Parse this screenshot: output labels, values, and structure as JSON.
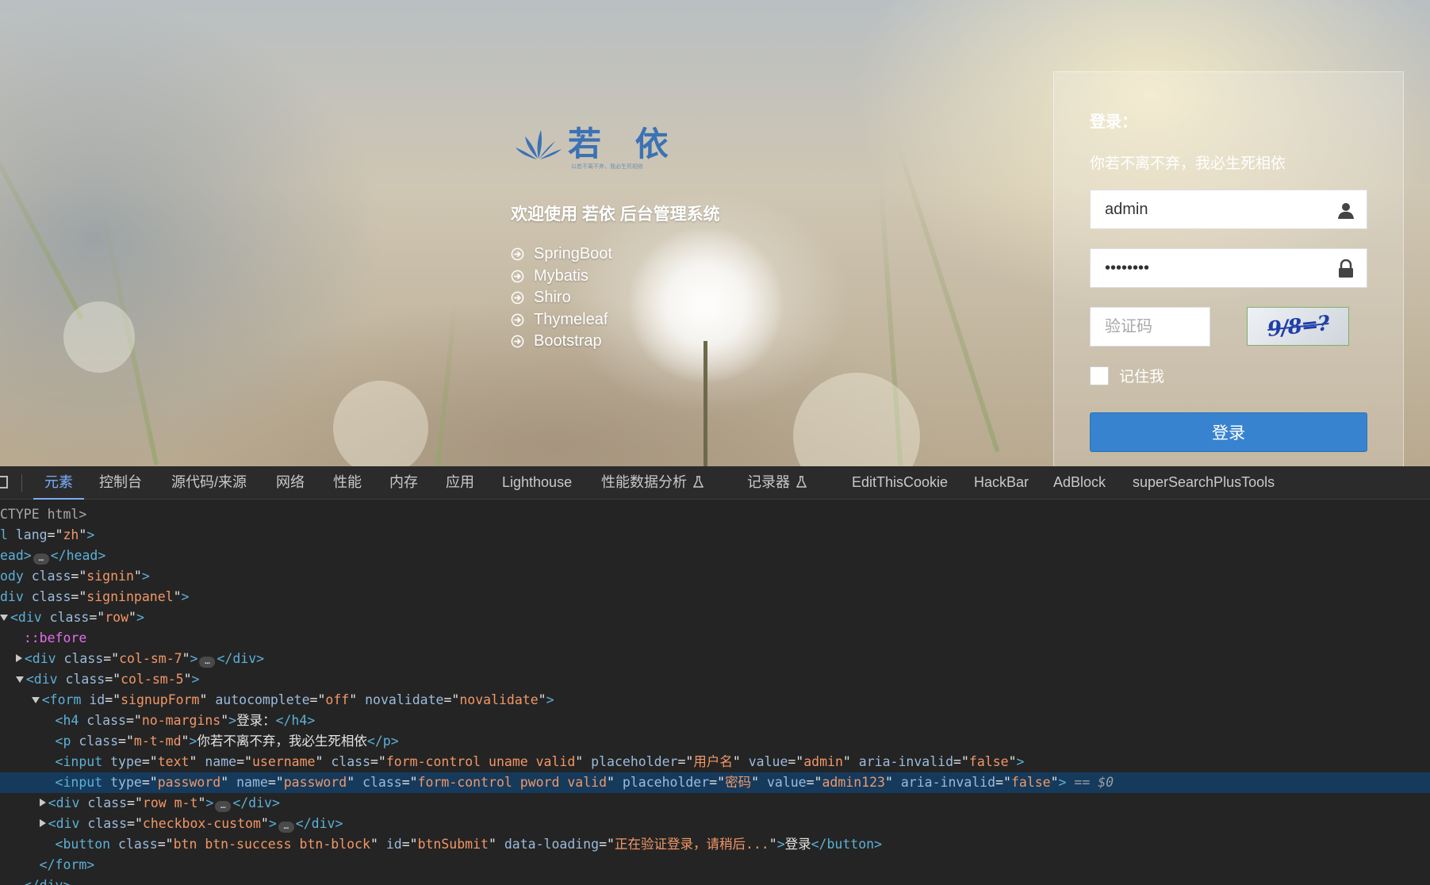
{
  "login_page": {
    "brand_name": "若 依",
    "brand_slogan": "以若不离不弃，我必生死相依",
    "welcome": "欢迎使用 若依 后台管理系统",
    "tech_stack": [
      "SpringBoot",
      "Mybatis",
      "Shiro",
      "Thymeleaf",
      "Bootstrap"
    ],
    "form": {
      "title": "登录：",
      "subtitle": "你若不离不弃，我必生死相依",
      "username_value": "admin",
      "username_placeholder": "用户名",
      "password_value": "admin123",
      "password_placeholder": "密码",
      "captcha_placeholder": "验证码",
      "captcha_text": "9/8=?",
      "remember_label": "记住我",
      "remember_checked": false,
      "submit_label": "登录"
    },
    "accent_color": "#3883d0"
  },
  "devtools": {
    "tabs": [
      {
        "label": "元素",
        "active": true
      },
      {
        "label": "控制台"
      },
      {
        "label": "源代码/来源"
      },
      {
        "label": "网络"
      },
      {
        "label": "性能"
      },
      {
        "label": "内存"
      },
      {
        "label": "应用"
      },
      {
        "label": "Lighthouse"
      },
      {
        "label": "性能数据分析",
        "icon": "flask-icon"
      },
      {
        "label": "记录器",
        "icon": "flask-icon"
      },
      {
        "label": "EditThisCookie"
      },
      {
        "label": "HackBar"
      },
      {
        "label": "AdBlock"
      },
      {
        "label": "superSearchPlusTools"
      }
    ],
    "dom_lines": [
      {
        "tokens": [
          [
            "cm",
            "CTYPE html>"
          ]
        ]
      },
      {
        "tokens": [
          [
            "tg",
            "l "
          ],
          [
            "an",
            "lang"
          ],
          [
            "tx",
            "=\""
          ],
          [
            "av",
            "zh"
          ],
          [
            "tx",
            "\""
          ],
          [
            "tg",
            ">"
          ]
        ]
      },
      {
        "tokens": [
          [
            "tg",
            "ead>"
          ],
          [
            "ell",
            "…"
          ],
          [
            "tg",
            "</head>"
          ]
        ]
      },
      {
        "tokens": [
          [
            "tg",
            "ody "
          ],
          [
            "an",
            "class"
          ],
          [
            "tx",
            "=\""
          ],
          [
            "av",
            "signin"
          ],
          [
            "tx",
            "\""
          ],
          [
            "tg",
            ">"
          ]
        ]
      },
      {
        "tokens": [
          [
            "tg",
            "div "
          ],
          [
            "an",
            "class"
          ],
          [
            "tx",
            "=\""
          ],
          [
            "av",
            "signinpanel"
          ],
          [
            "tx",
            "\""
          ],
          [
            "tg",
            ">"
          ]
        ]
      },
      {
        "tokens": [
          [
            "trid",
            ""
          ],
          [
            "tg",
            "<div "
          ],
          [
            "an",
            "class"
          ],
          [
            "tx",
            "=\""
          ],
          [
            "av",
            "row"
          ],
          [
            "tx",
            "\""
          ],
          [
            "tg",
            ">"
          ]
        ]
      },
      {
        "tokens": [
          [
            "tx",
            "   "
          ],
          [
            "ps",
            "::before"
          ]
        ]
      },
      {
        "tokens": [
          [
            "tx",
            "  "
          ],
          [
            "trir",
            ""
          ],
          [
            "tg",
            "<div "
          ],
          [
            "an",
            "class"
          ],
          [
            "tx",
            "=\""
          ],
          [
            "av",
            "col-sm-7"
          ],
          [
            "tx",
            "\""
          ],
          [
            "tg",
            ">"
          ],
          [
            "ell",
            "…"
          ],
          [
            "tg",
            "</div>"
          ]
        ]
      },
      {
        "tokens": [
          [
            "tx",
            "  "
          ],
          [
            "trid",
            ""
          ],
          [
            "tg",
            "<div "
          ],
          [
            "an",
            "class"
          ],
          [
            "tx",
            "=\""
          ],
          [
            "av",
            "col-sm-5"
          ],
          [
            "tx",
            "\""
          ],
          [
            "tg",
            ">"
          ]
        ]
      },
      {
        "tokens": [
          [
            "tx",
            "    "
          ],
          [
            "trid",
            ""
          ],
          [
            "tg",
            "<form "
          ],
          [
            "an",
            "id"
          ],
          [
            "tx",
            "=\""
          ],
          [
            "av",
            "signupForm"
          ],
          [
            "tx",
            "\" "
          ],
          [
            "an",
            "autocomplete"
          ],
          [
            "tx",
            "=\""
          ],
          [
            "av",
            "off"
          ],
          [
            "tx",
            "\" "
          ],
          [
            "an",
            "novalidate"
          ],
          [
            "tx",
            "=\""
          ],
          [
            "av",
            "novalidate"
          ],
          [
            "tx",
            "\""
          ],
          [
            "tg",
            ">"
          ]
        ]
      },
      {
        "tokens": [
          [
            "tx",
            "       "
          ],
          [
            "tg",
            "<h4 "
          ],
          [
            "an",
            "class"
          ],
          [
            "tx",
            "=\""
          ],
          [
            "av",
            "no-margins"
          ],
          [
            "tx",
            "\""
          ],
          [
            "tg",
            ">"
          ],
          [
            "tx",
            "登录："
          ],
          [
            "tg",
            "</h4>"
          ]
        ]
      },
      {
        "tokens": [
          [
            "tx",
            "       "
          ],
          [
            "tg",
            "<p "
          ],
          [
            "an",
            "class"
          ],
          [
            "tx",
            "=\""
          ],
          [
            "av",
            "m-t-md"
          ],
          [
            "tx",
            "\""
          ],
          [
            "tg",
            ">"
          ],
          [
            "tx",
            "你若不离不弃，我必生死相依"
          ],
          [
            "tg",
            "</p>"
          ]
        ]
      },
      {
        "tokens": [
          [
            "tx",
            "       "
          ],
          [
            "tg",
            "<input "
          ],
          [
            "an",
            "type"
          ],
          [
            "tx",
            "=\""
          ],
          [
            "av",
            "text"
          ],
          [
            "tx",
            "\" "
          ],
          [
            "an",
            "name"
          ],
          [
            "tx",
            "=\""
          ],
          [
            "av",
            "username"
          ],
          [
            "tx",
            "\" "
          ],
          [
            "an",
            "class"
          ],
          [
            "tx",
            "=\""
          ],
          [
            "av",
            "form-control uname valid"
          ],
          [
            "tx",
            "\" "
          ],
          [
            "an",
            "placeholder"
          ],
          [
            "tx",
            "=\""
          ],
          [
            "av",
            "用户名"
          ],
          [
            "tx",
            "\" "
          ],
          [
            "an",
            "value"
          ],
          [
            "tx",
            "=\""
          ],
          [
            "av",
            "admin"
          ],
          [
            "tx",
            "\" "
          ],
          [
            "an",
            "aria-invalid"
          ],
          [
            "tx",
            "=\""
          ],
          [
            "av",
            "false"
          ],
          [
            "tx",
            "\""
          ],
          [
            "tg",
            ">"
          ]
        ]
      },
      {
        "selected": true,
        "tokens": [
          [
            "tx",
            "       "
          ],
          [
            "tg",
            "<input "
          ],
          [
            "an",
            "type"
          ],
          [
            "tx",
            "=\""
          ],
          [
            "av",
            "password"
          ],
          [
            "tx",
            "\" "
          ],
          [
            "an",
            "name"
          ],
          [
            "tx",
            "=\""
          ],
          [
            "av",
            "password"
          ],
          [
            "tx",
            "\" "
          ],
          [
            "an",
            "class"
          ],
          [
            "tx",
            "=\""
          ],
          [
            "av",
            "form-control pword valid"
          ],
          [
            "tx",
            "\" "
          ],
          [
            "an",
            "placeholder"
          ],
          [
            "tx",
            "=\""
          ],
          [
            "av",
            "密码"
          ],
          [
            "tx",
            "\" "
          ],
          [
            "an",
            "value"
          ],
          [
            "tx",
            "=\""
          ],
          [
            "av",
            "admin123"
          ],
          [
            "tx",
            "\" "
          ],
          [
            "an",
            "aria-invalid"
          ],
          [
            "tx",
            "=\""
          ],
          [
            "av",
            "false"
          ],
          [
            "tx",
            "\""
          ],
          [
            "tg",
            ">"
          ],
          [
            "tx",
            " "
          ],
          [
            "dim",
            "== $0"
          ]
        ]
      },
      {
        "tokens": [
          [
            "tx",
            "     "
          ],
          [
            "trir",
            ""
          ],
          [
            "tg",
            "<div "
          ],
          [
            "an",
            "class"
          ],
          [
            "tx",
            "=\""
          ],
          [
            "av",
            "row m-t"
          ],
          [
            "tx",
            "\""
          ],
          [
            "tg",
            ">"
          ],
          [
            "ell",
            "…"
          ],
          [
            "tg",
            "</div>"
          ]
        ]
      },
      {
        "tokens": [
          [
            "tx",
            "     "
          ],
          [
            "trir",
            ""
          ],
          [
            "tg",
            "<div "
          ],
          [
            "an",
            "class"
          ],
          [
            "tx",
            "=\""
          ],
          [
            "av",
            "checkbox-custom"
          ],
          [
            "tx",
            "\""
          ],
          [
            "tg",
            ">"
          ],
          [
            "ell",
            "…"
          ],
          [
            "tg",
            "</div>"
          ]
        ]
      },
      {
        "tokens": [
          [
            "tx",
            "       "
          ],
          [
            "tg",
            "<button "
          ],
          [
            "an",
            "class"
          ],
          [
            "tx",
            "=\""
          ],
          [
            "av",
            "btn btn-success btn-block"
          ],
          [
            "tx",
            "\" "
          ],
          [
            "an",
            "id"
          ],
          [
            "tx",
            "=\""
          ],
          [
            "av",
            "btnSubmit"
          ],
          [
            "tx",
            "\" "
          ],
          [
            "an",
            "data-loading"
          ],
          [
            "tx",
            "=\""
          ],
          [
            "av",
            "正在验证登录，请稍后..."
          ],
          [
            "tx",
            "\""
          ],
          [
            "tg",
            ">"
          ],
          [
            "tx",
            "登录"
          ],
          [
            "tg",
            "</button>"
          ]
        ]
      },
      {
        "tokens": [
          [
            "tx",
            "     "
          ],
          [
            "tg",
            "</form>"
          ]
        ]
      },
      {
        "tokens": [
          [
            "tx",
            "   "
          ],
          [
            "tg",
            "</div>"
          ]
        ]
      }
    ]
  }
}
